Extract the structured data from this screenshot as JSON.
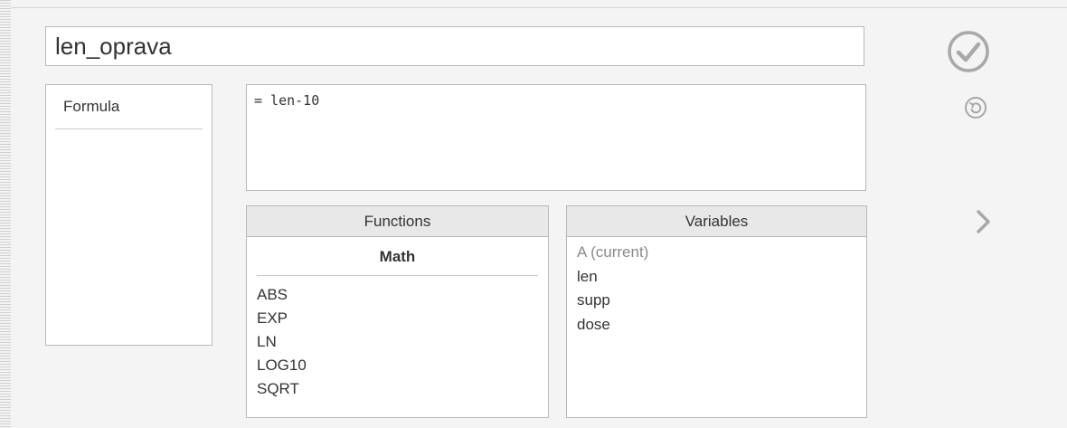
{
  "variable_name": "len_oprava",
  "options": [
    "Formula"
  ],
  "formula": "= len-10",
  "functions": {
    "header": "Functions",
    "category": "Math",
    "items": [
      "ABS",
      "EXP",
      "LN",
      "LOG10",
      "SQRT"
    ]
  },
  "variables": {
    "header": "Variables",
    "items": [
      "A (current)",
      "len",
      "supp",
      "dose"
    ]
  },
  "icons": {
    "ok": "check-circle-icon",
    "revert": "undo-icon",
    "next": "chevron-right-icon"
  },
  "colors": {
    "icon": "#a8a8a8",
    "border": "#b9b9b9",
    "header_bg": "#e8e8e8",
    "muted_text": "#8a8a8a"
  }
}
